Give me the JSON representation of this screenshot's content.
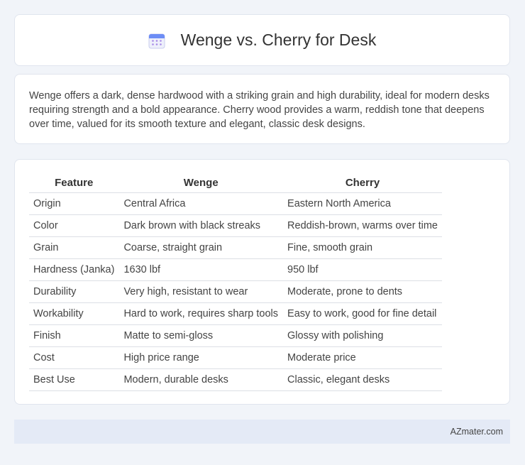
{
  "header": {
    "title": "Wenge vs. Cherry for Desk",
    "icon": "calendar-icon"
  },
  "intro": {
    "text": "Wenge offers a dark, dense hardwood with a striking grain and high durability, ideal for modern desks requiring strength and a bold appearance. Cherry wood provides a warm, reddish tone that deepens over time, valued for its smooth texture and elegant, classic desk designs."
  },
  "table": {
    "headers": [
      "Feature",
      "Wenge",
      "Cherry"
    ],
    "rows": [
      [
        "Origin",
        "Central Africa",
        "Eastern North America"
      ],
      [
        "Color",
        "Dark brown with black streaks",
        "Reddish-brown, warms over time"
      ],
      [
        "Grain",
        "Coarse, straight grain",
        "Fine, smooth grain"
      ],
      [
        "Hardness (Janka)",
        "1630 lbf",
        "950 lbf"
      ],
      [
        "Durability",
        "Very high, resistant to wear",
        "Moderate, prone to dents"
      ],
      [
        "Workability",
        "Hard to work, requires sharp tools",
        "Easy to work, good for fine detail"
      ],
      [
        "Finish",
        "Matte to semi-gloss",
        "Glossy with polishing"
      ],
      [
        "Cost",
        "High price range",
        "Moderate price"
      ],
      [
        "Best Use",
        "Modern, durable desks",
        "Classic, elegant desks"
      ]
    ]
  },
  "footer": {
    "site": "AZmater.com"
  }
}
